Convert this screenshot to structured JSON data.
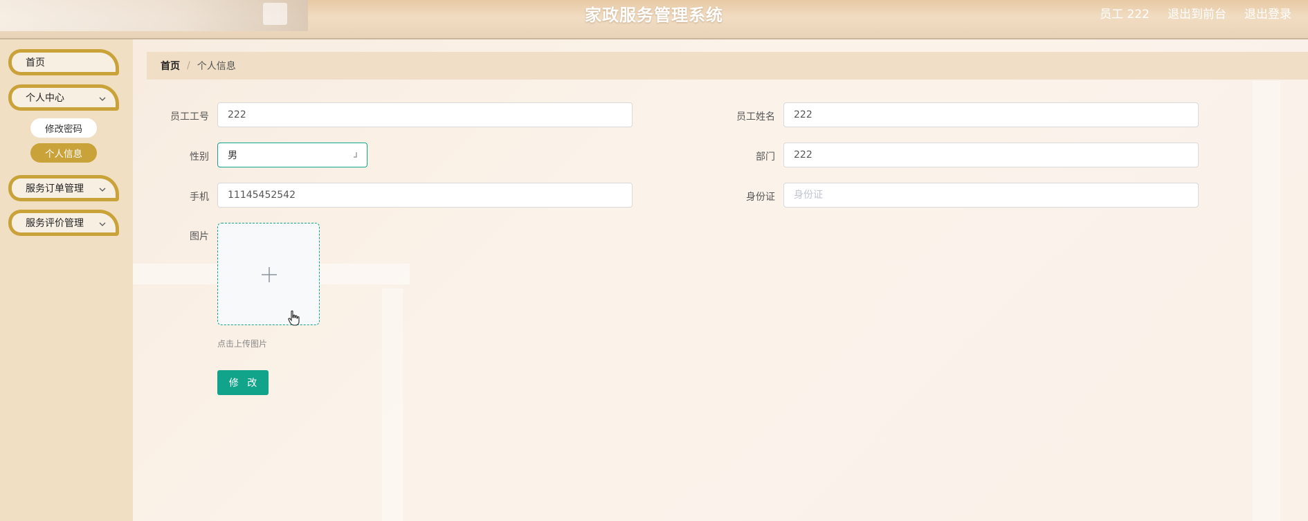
{
  "header": {
    "title": "家政服务管理系统",
    "user_label": "员工 222",
    "front_link": "退出到前台",
    "logout_link": "退出登录"
  },
  "sidebar": {
    "items": [
      {
        "label": "首页"
      },
      {
        "label": "个人中心",
        "expanded": true,
        "children": [
          {
            "label": "修改密码"
          },
          {
            "label": "个人信息",
            "active": true
          }
        ]
      },
      {
        "label": "服务订单管理"
      },
      {
        "label": "服务评价管理"
      }
    ]
  },
  "breadcrumb": {
    "home": "首页",
    "separator": "/",
    "current": "个人信息"
  },
  "form": {
    "employee_no": {
      "label": "员工工号",
      "value": "222"
    },
    "employee_name": {
      "label": "员工姓名",
      "value": "222"
    },
    "gender": {
      "label": "性别",
      "value": "男"
    },
    "department": {
      "label": "部门",
      "value": "222"
    },
    "phone": {
      "label": "手机",
      "value": "11145452542"
    },
    "id_card": {
      "label": "身份证",
      "value": "",
      "placeholder": "身份证"
    },
    "picture": {
      "label": "图片",
      "tip": "点击上传图片"
    },
    "submit_label": "修 改"
  },
  "colors": {
    "accent": "#12a48a",
    "menu_border": "#c9a23a",
    "sidebar_bg": "#f1dfc4",
    "breadcrumb_bg": "#f0dfc6"
  },
  "icons": {
    "menu_expand": "chevron-down-icon",
    "upload": "plus-icon",
    "select_arrow": "select-arrow-icon",
    "cursor": "hand-cursor-icon"
  }
}
